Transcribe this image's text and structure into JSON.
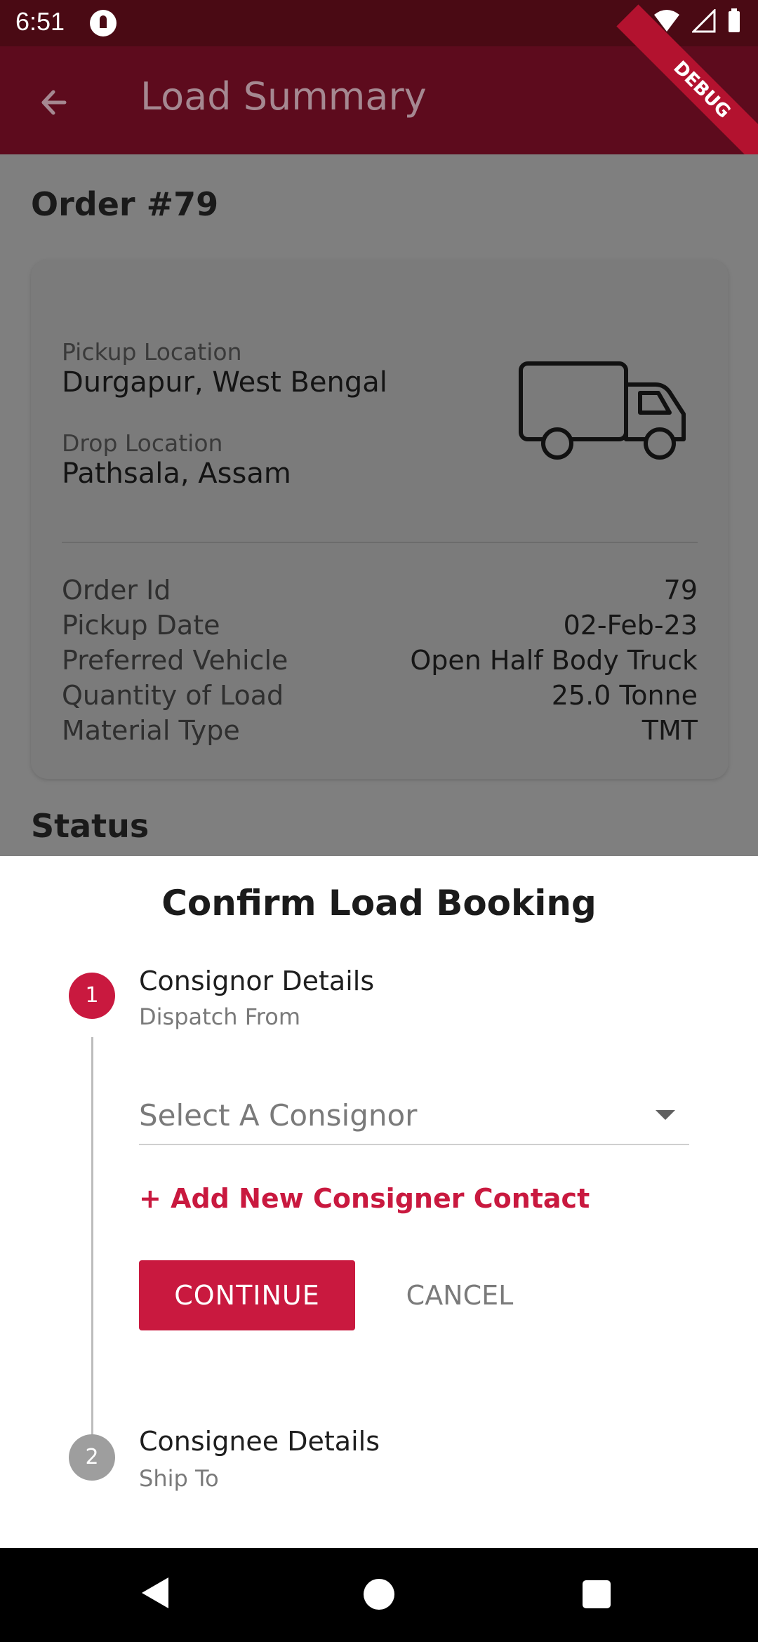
{
  "status_bar": {
    "time": "6:51"
  },
  "app_bar": {
    "title": "Load Summary",
    "debug_label": "DEBUG"
  },
  "order": {
    "title": "Order #79",
    "pickup_label": "Pickup Location",
    "pickup_value": "Durgapur, West Bengal",
    "drop_label": "Drop Location",
    "drop_value": "Pathsala, Assam",
    "details": [
      {
        "key": "Order Id",
        "value": "79"
      },
      {
        "key": "Pickup Date",
        "value": "02-Feb-23"
      },
      {
        "key": "Preferred Vehicle",
        "value": "Open Half Body Truck"
      },
      {
        "key": "Quantity of Load",
        "value": "25.0 Tonne"
      },
      {
        "key": "Material Type",
        "value": "TMT"
      }
    ],
    "status_heading": "Status"
  },
  "sheet": {
    "title": "Confirm Load Booking",
    "step1": {
      "number": "1",
      "title": "Consignor Details",
      "subtitle": "Dispatch From"
    },
    "select_placeholder": "Select A Consignor",
    "add_link": "+ Add New Consigner Contact",
    "continue_label": "CONTINUE",
    "cancel_label": "CANCEL",
    "step2": {
      "number": "2",
      "title": "Consignee Details",
      "subtitle": "Ship To"
    }
  },
  "colors": {
    "accent": "#c9193f",
    "app_bar": "#5d0b1d",
    "status_bar": "#4a0a14"
  }
}
